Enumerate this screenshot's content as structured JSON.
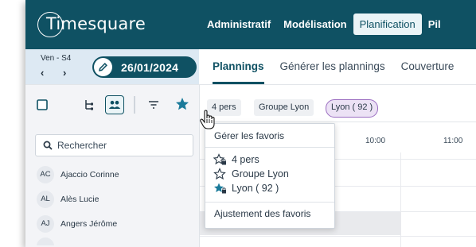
{
  "app": {
    "logo_text": "Timesquare"
  },
  "nav": {
    "items": [
      "Administratif",
      "Modélisation",
      "Planification",
      "Pil"
    ],
    "active_index": 2
  },
  "date": {
    "day_label": "Ven - S4",
    "prev_arrow": "‹",
    "next_arrow": "›",
    "current": "26/01/2024"
  },
  "tabs": {
    "items": [
      "Plannings",
      "Générer les plannings",
      "Couverture"
    ],
    "active_index": 0
  },
  "search": {
    "placeholder": "Rechercher"
  },
  "users": [
    {
      "initials": "AC",
      "name": "Ajaccio Corinne"
    },
    {
      "initials": "AL",
      "name": "Alès Lucie"
    },
    {
      "initials": "AJ",
      "name": "Angers Jérôme"
    }
  ],
  "chips": [
    {
      "label": "4 pers",
      "selected": false
    },
    {
      "label": "Groupe Lyon",
      "selected": false
    },
    {
      "label": "Lyon ( 92 )",
      "selected": true
    }
  ],
  "timeline": {
    "hours": [
      "10:00",
      "11:00"
    ]
  },
  "favorites_menu": {
    "header": "Gérer les favoris",
    "items": [
      {
        "label": "4 pers",
        "icon": "star-outline-lock-icon"
      },
      {
        "label": "Groupe Lyon",
        "icon": "star-outline-icon"
      },
      {
        "label": "Lyon ( 92 )",
        "icon": "star-filled-lock-icon"
      }
    ],
    "footer": "Ajustement des favoris"
  },
  "colors": {
    "brand": "#0f5163",
    "accent_star": "#1a7a9a",
    "selected_chip_border": "#9a6cc0"
  }
}
